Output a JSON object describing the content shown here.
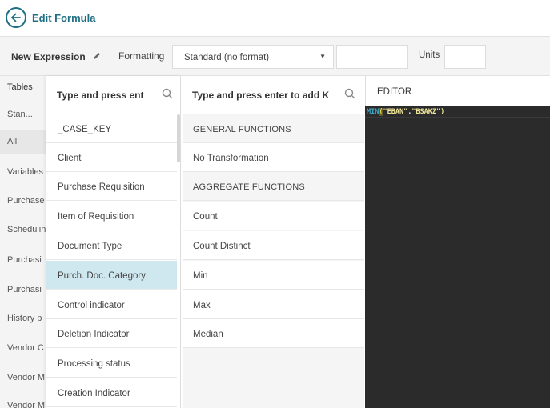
{
  "header": {
    "title": "Edit Formula"
  },
  "toolbar": {
    "expression_name": "New Expression",
    "formatting_label": "Formatting",
    "formatting_value": "Standard (no format)",
    "units_label": "Units"
  },
  "tables": {
    "header": "Tables",
    "items": [
      "Stan...",
      "All",
      "Variables",
      "Purchase",
      "Schedulin",
      "Purchasi",
      "Purchasi",
      "History p",
      "Vendor C",
      "Vendor M",
      "Vendor M"
    ]
  },
  "keys": {
    "search_placeholder": "Type and press ent",
    "items": [
      "_CASE_KEY",
      "Client",
      "Purchase Requisition",
      "Item of Requisition",
      "Document Type",
      "Purch. Doc. Category",
      "Control indicator",
      "Deletion Indicator",
      "Processing status",
      "Creation Indicator"
    ],
    "selected": "Purch. Doc. Category"
  },
  "functions": {
    "search_placeholder": "Type and press enter to add K",
    "items": [
      {
        "label": "GENERAL FUNCTIONS",
        "type": "header"
      },
      {
        "label": "No Transformation",
        "type": "item"
      },
      {
        "label": "AGGREGATE FUNCTIONS",
        "type": "header"
      },
      {
        "label": "Count",
        "type": "item"
      },
      {
        "label": "Count Distinct",
        "type": "item"
      },
      {
        "label": "Min",
        "type": "item"
      },
      {
        "label": "Max",
        "type": "item"
      },
      {
        "label": "Median",
        "type": "item"
      }
    ]
  },
  "editor": {
    "title": "EDITOR",
    "code_fn": "MIN",
    "code_open": "(",
    "code_table": "\"EBAN\"",
    "code_dot": ".",
    "code_column": "\"BSAKZ\"",
    "code_close": ")"
  },
  "colors": {
    "accent": "#1f6f84",
    "selected_row": "#cfe7ef",
    "editor_bg": "#2b2b2b"
  },
  "icons": [
    "arrow-left-icon",
    "pencil-icon",
    "chevron-down-icon",
    "search-icon"
  ]
}
